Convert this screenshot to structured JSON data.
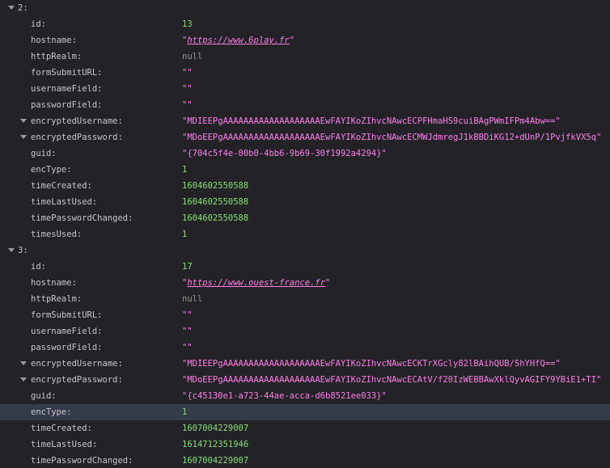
{
  "entries": [
    {
      "index_label": "2:",
      "fields": [
        {
          "key": "id:",
          "type": "number",
          "value": "13"
        },
        {
          "key": "hostname:",
          "type": "url",
          "value": "https://www.6play.fr"
        },
        {
          "key": "httpRealm:",
          "type": "null",
          "value": "null"
        },
        {
          "key": "formSubmitURL:",
          "type": "string",
          "value": "\"\""
        },
        {
          "key": "usernameField:",
          "type": "string",
          "value": "\"\""
        },
        {
          "key": "passwordField:",
          "type": "string",
          "value": "\"\""
        },
        {
          "key": "encryptedUsername:",
          "type": "string",
          "expandable": true,
          "value": "\"MDIEEPgAAAAAAAAAAAAAAAAAAAEwFAYIKoZIhvcNAwcECPFHmaHS9cuiBAgPWmIFPm4Abw==\""
        },
        {
          "key": "encryptedPassword:",
          "type": "string",
          "expandable": true,
          "value": "\"MDoEEPgAAAAAAAAAAAAAAAAAAAEwFAYIKoZIhvcNAwcECMWJdmregJ1kBBDiKG12+dUnP/1PvjfkVX5q\""
        },
        {
          "key": "guid:",
          "type": "string",
          "value": "\"{704c5f4e-00b0-4bb6-9b69-30f1992a4294}\""
        },
        {
          "key": "encType:",
          "type": "number",
          "value": "1"
        },
        {
          "key": "timeCreated:",
          "type": "number",
          "value": "1604602550588"
        },
        {
          "key": "timeLastUsed:",
          "type": "number",
          "value": "1604602550588"
        },
        {
          "key": "timePasswordChanged:",
          "type": "number",
          "value": "1604602550588"
        },
        {
          "key": "timesUsed:",
          "type": "number",
          "value": "1"
        }
      ]
    },
    {
      "index_label": "3:",
      "fields": [
        {
          "key": "id:",
          "type": "number",
          "value": "17"
        },
        {
          "key": "hostname:",
          "type": "url",
          "value": "https://www.ouest-france.fr"
        },
        {
          "key": "httpRealm:",
          "type": "null",
          "value": "null"
        },
        {
          "key": "formSubmitURL:",
          "type": "string",
          "value": "\"\""
        },
        {
          "key": "usernameField:",
          "type": "string",
          "value": "\"\""
        },
        {
          "key": "passwordField:",
          "type": "string",
          "value": "\"\""
        },
        {
          "key": "encryptedUsername:",
          "type": "string",
          "expandable": true,
          "value": "\"MDIEEPgAAAAAAAAAAAAAAAAAAAEwFAYIKoZIhvcNAwcECKTrXGcly82lBAihQUB/ShYHfQ==\""
        },
        {
          "key": "encryptedPassword:",
          "type": "string",
          "expandable": true,
          "value": "\"MDoEEPgAAAAAAAAAAAAAAAAAAAEwFAYIKoZIhvcNAwcECAtV/f20IzWEBBAwXklQyvAGIFY9YBiE1+TI\""
        },
        {
          "key": "guid:",
          "type": "string",
          "value": "\"{c45130e1-a723-44ae-acca-d6b8521ee033}\""
        },
        {
          "key": "encType:",
          "type": "number",
          "value": "1",
          "selected": true
        },
        {
          "key": "timeCreated:",
          "type": "number",
          "value": "1607004229007"
        },
        {
          "key": "timeLastUsed:",
          "type": "number",
          "value": "1614712351946"
        },
        {
          "key": "timePasswordChanged:",
          "type": "number",
          "value": "1607004229007"
        }
      ]
    }
  ],
  "colors": {
    "background": "#232327",
    "key": "#c5c5cc",
    "string": "#ff7de9",
    "number": "#86de74",
    "null": "#939395",
    "selected_row": "#353b48",
    "twisty": "#9a9aa3"
  },
  "icons": {
    "expand": "chevron-down-icon"
  }
}
